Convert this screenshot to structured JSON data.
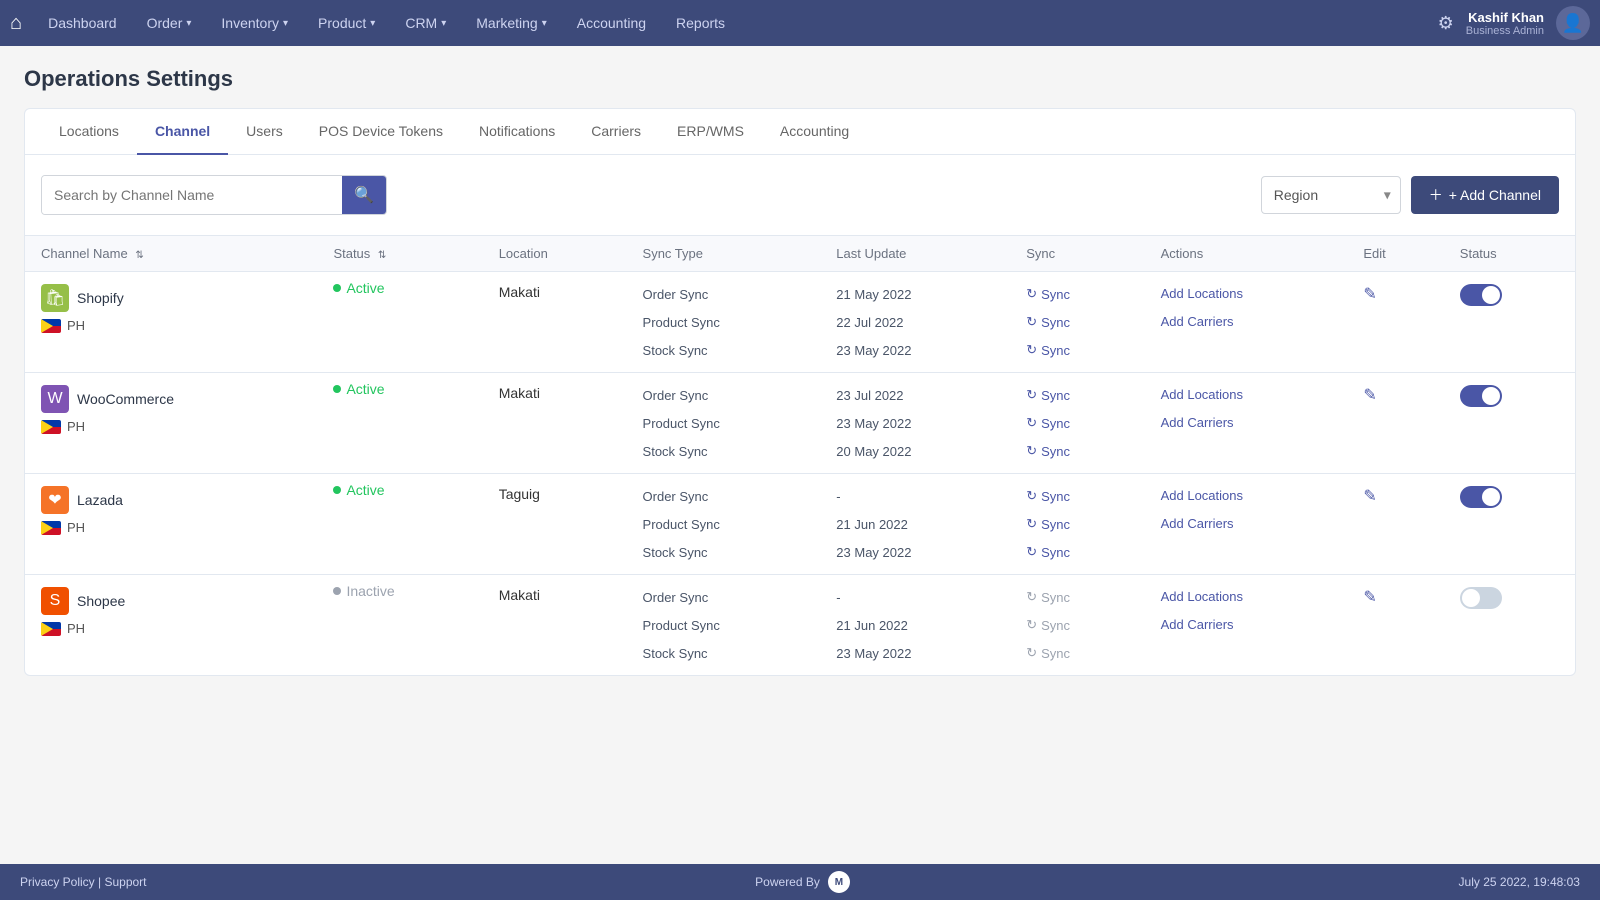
{
  "nav": {
    "home_icon": "⌂",
    "items": [
      {
        "label": "Dashboard",
        "has_arrow": false
      },
      {
        "label": "Order",
        "has_arrow": true
      },
      {
        "label": "Inventory",
        "has_arrow": true
      },
      {
        "label": "Product",
        "has_arrow": true
      },
      {
        "label": "CRM",
        "has_arrow": true
      },
      {
        "label": "Marketing",
        "has_arrow": true
      },
      {
        "label": "Accounting",
        "has_arrow": false
      },
      {
        "label": "Reports",
        "has_arrow": false
      }
    ],
    "user": {
      "name": "Kashif Khan",
      "role": "Business Admin"
    }
  },
  "page": {
    "title": "Operations Settings"
  },
  "tabs": [
    {
      "label": "Locations",
      "active": false
    },
    {
      "label": "Channel",
      "active": true
    },
    {
      "label": "Users",
      "active": false
    },
    {
      "label": "POS Device Tokens",
      "active": false
    },
    {
      "label": "Notifications",
      "active": false
    },
    {
      "label": "Carriers",
      "active": false
    },
    {
      "label": "ERP/WMS",
      "active": false
    },
    {
      "label": "Accounting",
      "active": false
    }
  ],
  "toolbar": {
    "search_placeholder": "Search by Channel Name",
    "search_icon": "🔍",
    "region_label": "Region",
    "add_channel_label": "+ Add Channel"
  },
  "table": {
    "headers": [
      {
        "label": "Channel Name",
        "sortable": true
      },
      {
        "label": "Status",
        "sortable": true
      },
      {
        "label": "Location",
        "sortable": false
      },
      {
        "label": "Sync Type",
        "sortable": false
      },
      {
        "label": "Last Update",
        "sortable": false
      },
      {
        "label": "Sync",
        "sortable": false
      },
      {
        "label": "Actions",
        "sortable": false
      },
      {
        "label": "Edit",
        "sortable": false
      },
      {
        "label": "Status",
        "sortable": false
      }
    ],
    "rows": [
      {
        "id": "shopify",
        "name": "Shopify",
        "icon": "🛍",
        "icon_bg": "#96bf48",
        "status": "Active",
        "status_type": "active",
        "location": "Makati",
        "country": "PH",
        "enabled": true,
        "syncs": [
          {
            "type": "Order Sync",
            "last_update": "21 May 2022"
          },
          {
            "type": "Product Sync",
            "last_update": "22 Jul 2022"
          },
          {
            "type": "Stock Sync",
            "last_update": "23 May 2022"
          }
        ]
      },
      {
        "id": "woocommerce",
        "name": "WooCommerce",
        "icon": "W",
        "icon_bg": "#7f54b3",
        "status": "Active",
        "status_type": "active",
        "location": "Makati",
        "country": "PH",
        "enabled": true,
        "syncs": [
          {
            "type": "Order Sync",
            "last_update": "23 Jul 2022"
          },
          {
            "type": "Product Sync",
            "last_update": "23 May 2022"
          },
          {
            "type": "Stock Sync",
            "last_update": "20 May 2022"
          }
        ]
      },
      {
        "id": "lazada",
        "name": "Lazada",
        "icon": "❤",
        "icon_bg": "#f57328",
        "status": "Active",
        "status_type": "active",
        "location": "Taguig",
        "country": "PH",
        "enabled": true,
        "syncs": [
          {
            "type": "Order Sync",
            "last_update": "-"
          },
          {
            "type": "Product Sync",
            "last_update": "21 Jun 2022"
          },
          {
            "type": "Stock Sync",
            "last_update": "23 May 2022"
          }
        ]
      },
      {
        "id": "shopee",
        "name": "Shopee",
        "icon": "S",
        "icon_bg": "#f05000",
        "status": "Inactive",
        "status_type": "inactive",
        "location": "Makati",
        "country": "PH",
        "enabled": false,
        "syncs": [
          {
            "type": "Order Sync",
            "last_update": "-"
          },
          {
            "type": "Product Sync",
            "last_update": "21 Jun 2022"
          },
          {
            "type": "Stock Sync",
            "last_update": "23 May 2022"
          }
        ]
      }
    ]
  },
  "footer": {
    "left": "acy Policy | Support",
    "powered_by": "Powered By",
    "datetime": "July 25 2022, 19:48:03"
  }
}
